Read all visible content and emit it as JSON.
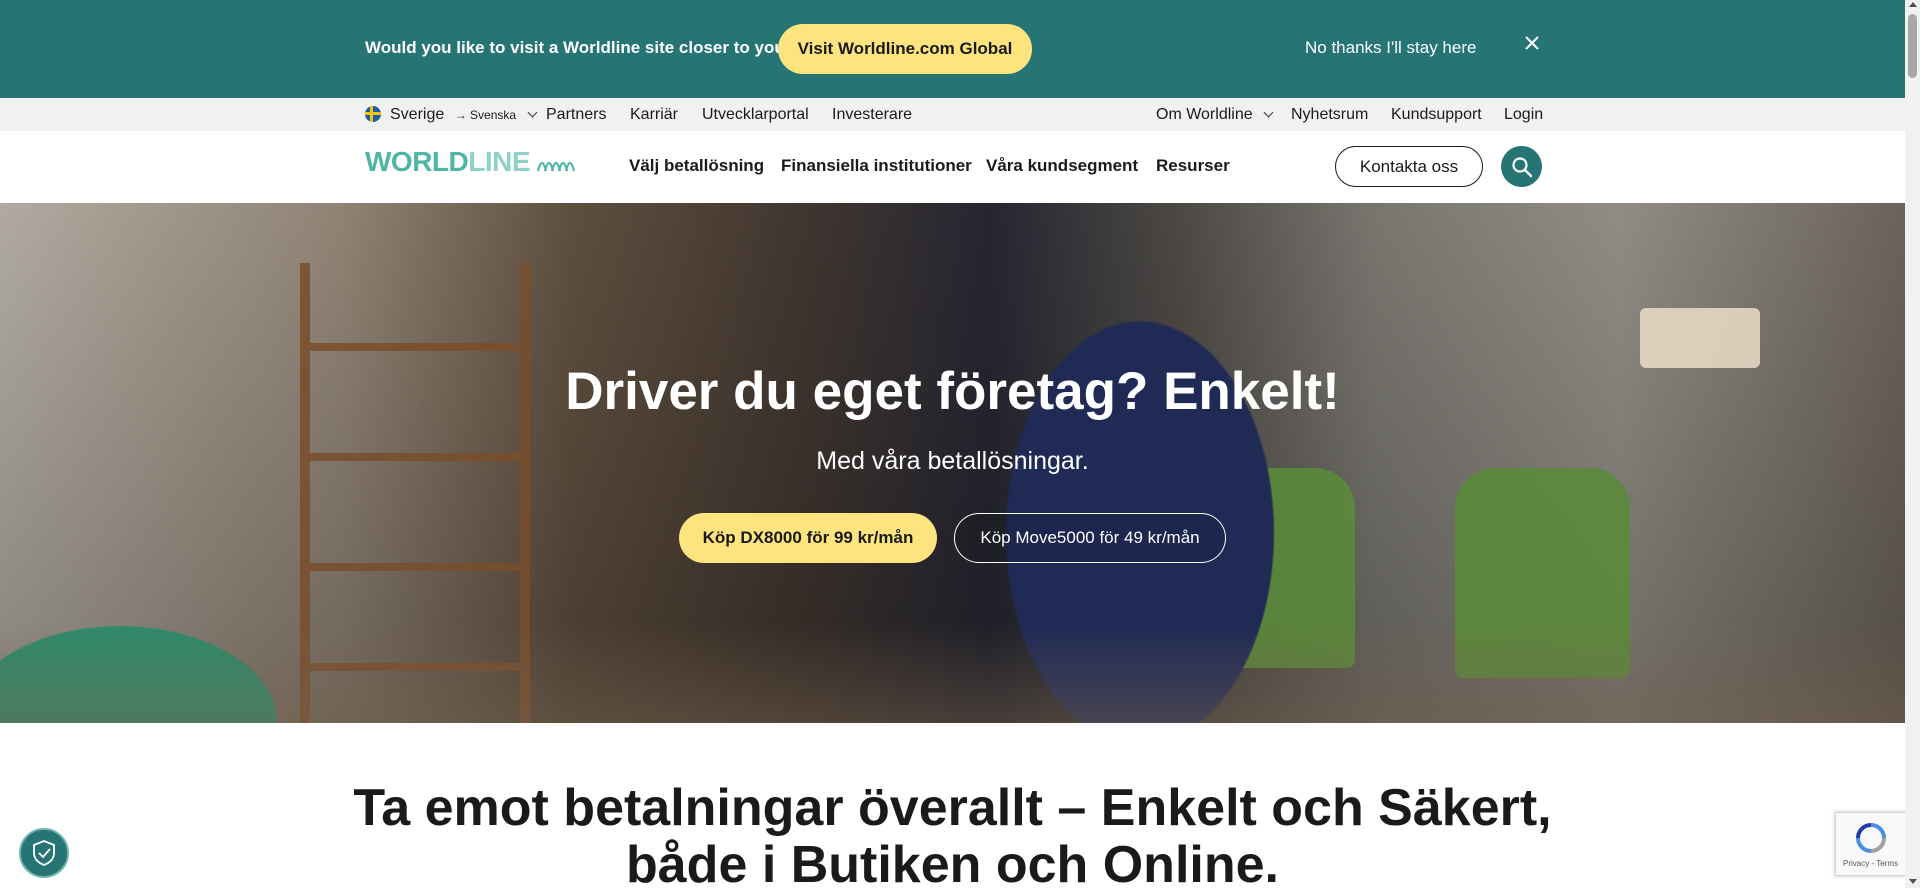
{
  "geo_banner": {
    "question": "Would you like to visit a Worldline site closer to you?",
    "visit_label": "Visit Worldline.com Global",
    "stay_label": "No thanks I'll stay here",
    "close_icon": "close-icon"
  },
  "utility_bar": {
    "country": "Sverige",
    "language": "→ Svenska",
    "left_links": [
      "Partners",
      "Karriär",
      "Utvecklarportal",
      "Investerare"
    ],
    "right_links": [
      "Om Worldline",
      "Nyhetsrum",
      "Kundsupport",
      "Login"
    ]
  },
  "main_nav": {
    "logo_text_a": "WORLD",
    "logo_text_b": "LINE",
    "items": [
      "Välj betallösning",
      "Finansiella institutioner",
      "Våra kundsegment",
      "Resurser"
    ],
    "contact_label": "Kontakta oss",
    "search_icon": "search-icon"
  },
  "hero": {
    "title": "Driver du eget företag? Enkelt!",
    "subtitle": "Med våra betallösningar.",
    "primary_cta": "Köp DX8000 för 99 kr/mån",
    "secondary_cta": "Köp Move5000 för 49 kr/mån"
  },
  "section": {
    "title_line1": "Ta emot betalningar överallt – Enkelt och Säkert,",
    "title_line2": "både i Butiken och Online."
  },
  "widgets": {
    "recaptcha_links": "Privacy - Terms"
  },
  "colors": {
    "teal": "#267474",
    "yellow": "#fde47e",
    "logo_teal": "#4fb5a6"
  }
}
